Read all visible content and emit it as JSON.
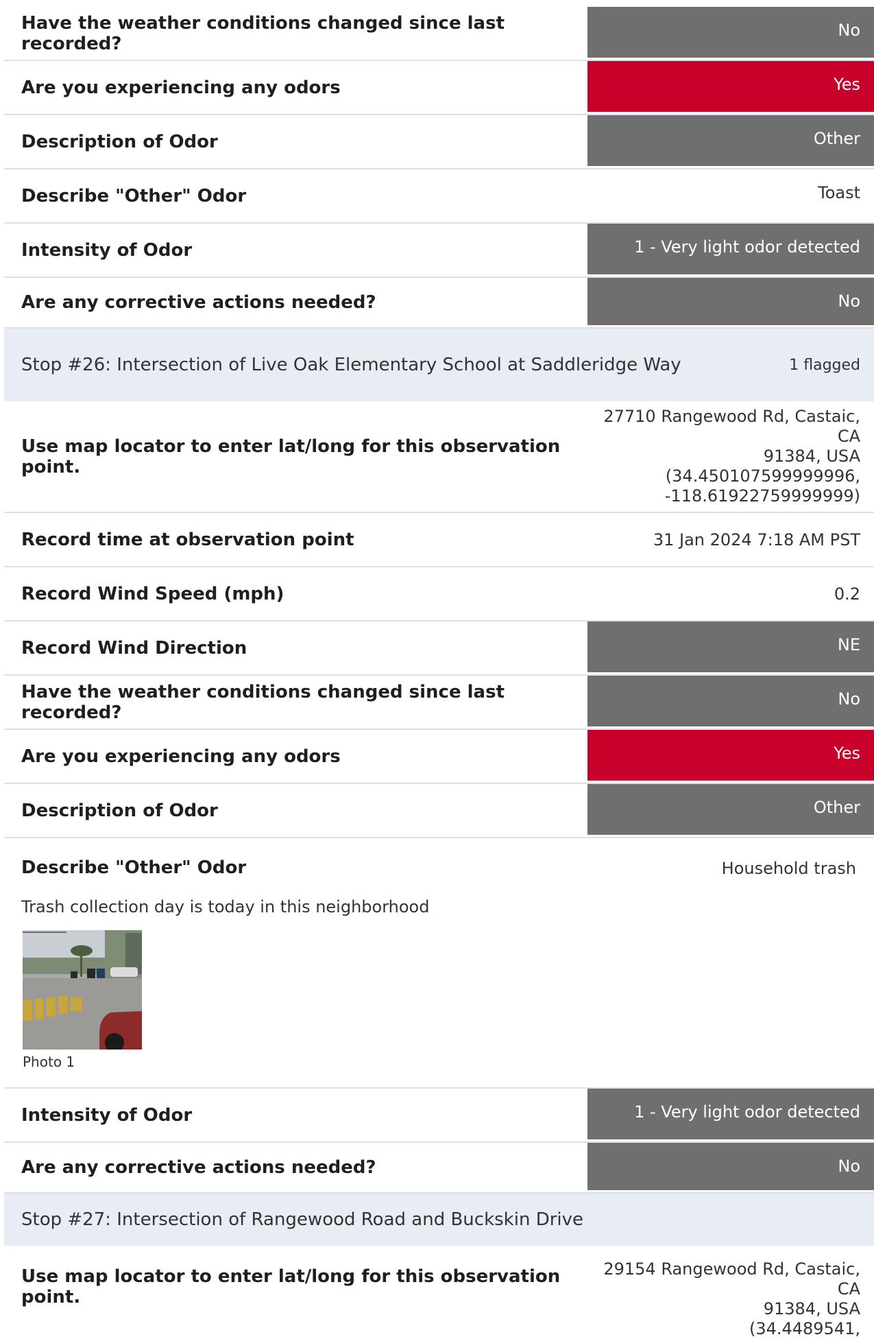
{
  "rows": [
    {
      "question": "Have the weather conditions changed since last recorded?",
      "answer": "No"
    },
    {
      "question": "Are you experiencing any odors",
      "answer": "Yes"
    },
    {
      "question": "Description of Odor",
      "answer": "Other"
    },
    {
      "question": "Describe \"Other\" Odor",
      "answer": "Toast"
    },
    {
      "question": "Intensity of Odor",
      "answer": "1 - Very light odor detected"
    },
    {
      "question": "Are any corrective actions needed?",
      "answer": "No"
    }
  ],
  "stop26": {
    "title": "Stop #26: Intersection of Live Oak Elementary School at Saddleridge Way",
    "flag": "1 flagged",
    "location": {
      "question": "Use map locator to enter lat/long for this observation point.",
      "line1": "27710 Rangewood Rd, Castaic, CA",
      "line2": "91384, USA",
      "line3": "(34.450107599999996,",
      "line4": "-118.61922759999999)"
    },
    "time": {
      "question": "Record time at observation point",
      "answer": "31 Jan 2024 7:18 AM PST"
    },
    "wind_speed": {
      "question": "Record Wind Speed (mph)",
      "answer": "0.2"
    },
    "wind_dir": {
      "question": "Record Wind Direction",
      "answer": "NE"
    },
    "weather": {
      "question": "Have the weather conditions changed since last recorded?",
      "answer": "No"
    },
    "odors": {
      "question": "Are you experiencing any odors",
      "answer": "Yes"
    },
    "desc": {
      "question": "Description of Odor",
      "answer": "Other"
    },
    "other": {
      "question": "Describe \"Other\" Odor",
      "answer": "Household trash",
      "note": "Trash collection day is today in this neighborhood",
      "photo_caption": "Photo 1"
    },
    "intensity": {
      "question": "Intensity of Odor",
      "answer": "1 - Very light odor detected"
    },
    "corrective": {
      "question": "Are any corrective actions needed?",
      "answer": "No"
    }
  },
  "stop27": {
    "title": "Stop #27: Intersection of Rangewood Road and Buckskin Drive",
    "location": {
      "question": "Use map locator to enter lat/long for this observation point.",
      "line1": "29154 Rangewood Rd, Castaic, CA",
      "line2": "91384, USA",
      "line3": "(34.4489541,"
    }
  },
  "colors": {
    "gray": "#6f6f6f",
    "red": "#c8002a",
    "section": "#e8ecf4"
  }
}
